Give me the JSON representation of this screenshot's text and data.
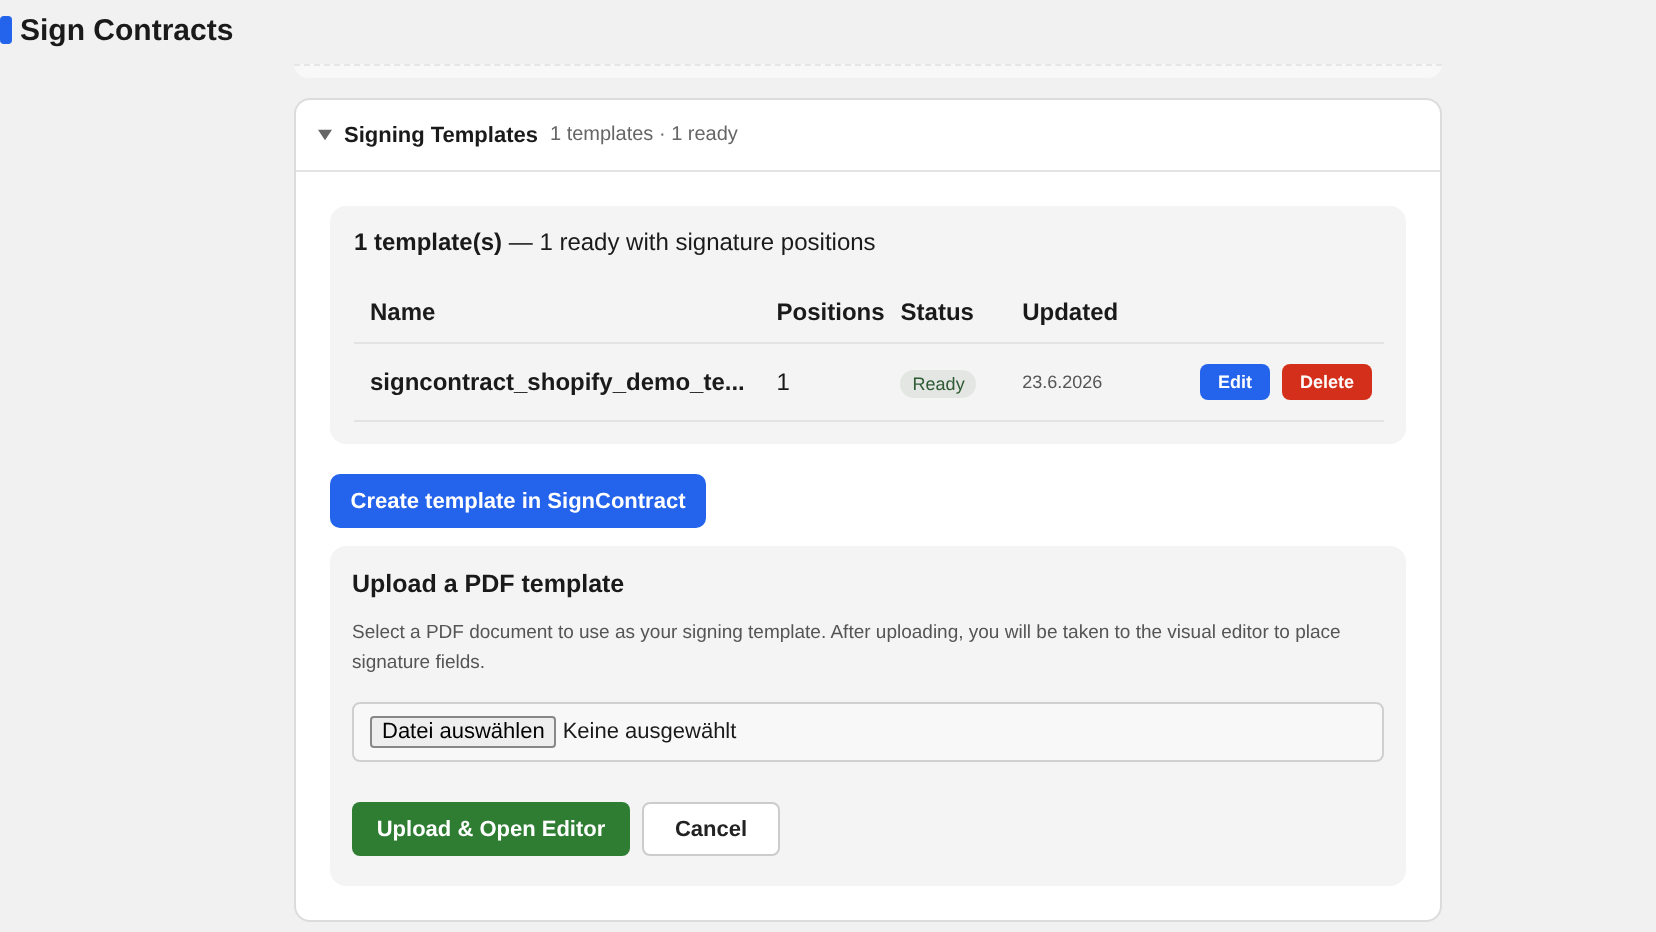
{
  "app": {
    "title": "Sign Contracts"
  },
  "section": {
    "title": "Signing Templates",
    "summary": "1 templates · 1 ready",
    "expanded": true
  },
  "templates": {
    "summary": "**1 template(s)** — 1 ready with signature positions",
    "columns": [
      "Name",
      "Positions",
      "Status",
      "Updated"
    ],
    "rows": [
      {
        "name": "signcontract_shopify_demo_te...",
        "positions": "1",
        "status": "Ready",
        "updated": "23.6.2026",
        "actions": [
          "Edit",
          "Delete"
        ]
      }
    ]
  },
  "create_button": "Create template in SignContract",
  "upload": {
    "title": "Upload a PDF template",
    "description": "Select a PDF document to use as your signing template. After uploading, you will be taken to the visual editor to place signature fields.",
    "file_button": "Datei auswählen",
    "file_status": "Keine ausgewählt",
    "submit": "Upload & Open Editor",
    "cancel": "Cancel"
  }
}
